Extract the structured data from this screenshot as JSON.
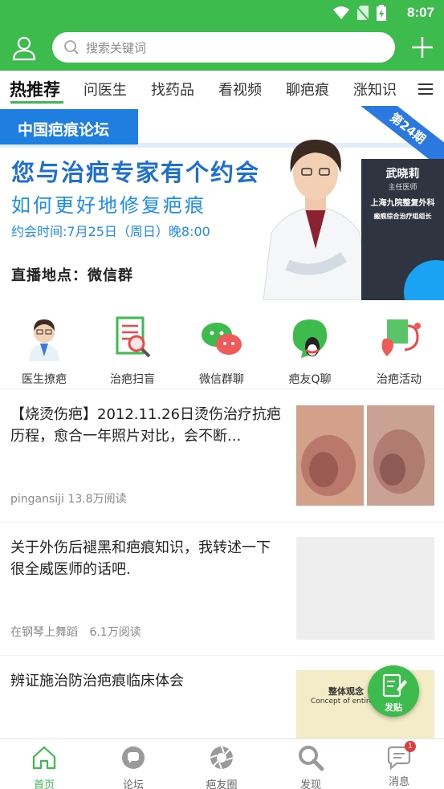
{
  "status_bar": {
    "time": "8:07"
  },
  "header": {
    "search_placeholder": "搜索关键词"
  },
  "tabs": [
    "热推荐",
    "问医生",
    "找药品",
    "看视频",
    "聊疤痕",
    "涨知识"
  ],
  "banner": {
    "tag": "中国疤痕论坛",
    "issue": "第24期",
    "title": "您与治疤专家有个约会",
    "subtitle": "如何更好地修复疤痕",
    "time": "约会时间:7月25日（周日）晚8:00",
    "place": "直播地点：微信群",
    "doctor_name": "武晓莉",
    "doctor_title": "主任医师",
    "doctor_hospital_1": "上海九院整复外科",
    "doctor_hospital_2": "瘢痕综合治疗组组长"
  },
  "quick_links": [
    {
      "label": "医生撩疤",
      "icon": "doctor-icon"
    },
    {
      "label": "治疤扫盲",
      "icon": "checklist-magnifier-icon"
    },
    {
      "label": "微信群聊",
      "icon": "wechat-icon"
    },
    {
      "label": "疤友Q聊",
      "icon": "qq-icon"
    },
    {
      "label": "治疤活动",
      "icon": "stethoscope-heart-icon"
    }
  ],
  "articles": [
    {
      "title": "【烧烫伤疤】2012.11.26日烫伤治疗抗疤历程，愈合一年照片对比，会不断...",
      "author": "pingansiji",
      "reads": "13.8万阅读"
    },
    {
      "title": "关于外伤后褪黑和疤痕知识，我转述一下很全威医师的话吧.",
      "author": "在钢琴上舞蹈",
      "reads": "6.1万阅读"
    },
    {
      "title": "辨证施治防治疤痕临床体会",
      "thumb_text_1": "整体观念",
      "thumb_text_2": "Concept of entirety and"
    }
  ],
  "fab": {
    "label": "发贴"
  },
  "bottom_nav": [
    {
      "label": "首页",
      "icon": "home-icon"
    },
    {
      "label": "论坛",
      "icon": "forum-icon"
    },
    {
      "label": "疤友圈",
      "icon": "aperture-icon"
    },
    {
      "label": "发现",
      "icon": "discover-search-icon"
    },
    {
      "label": "消息",
      "icon": "message-icon",
      "badge": "1"
    }
  ],
  "colors": {
    "brand": "#3dbb4d",
    "banner_blue": "#1f7fe0",
    "badge": "#e23b3b"
  }
}
